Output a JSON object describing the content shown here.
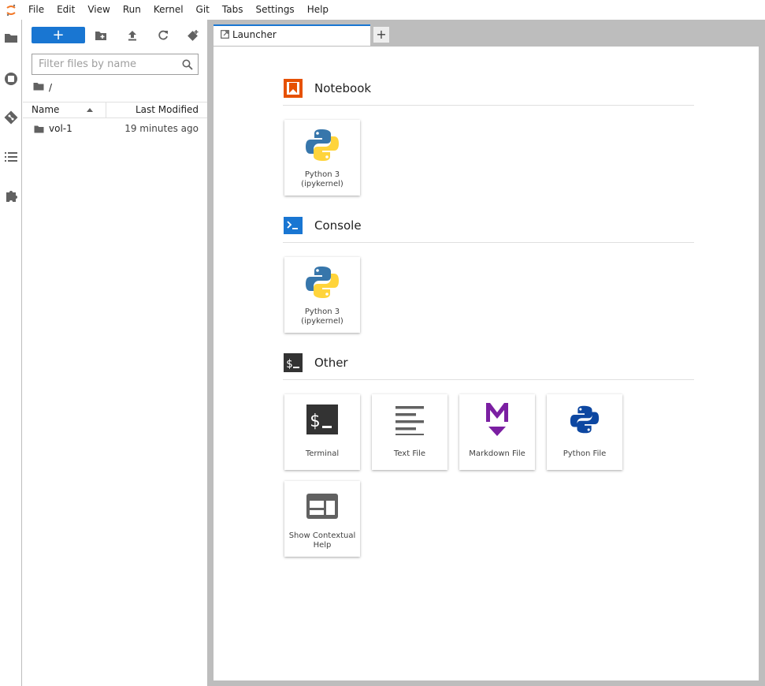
{
  "menu": [
    "File",
    "Edit",
    "View",
    "Run",
    "Kernel",
    "Git",
    "Tabs",
    "Settings",
    "Help"
  ],
  "activity_icons": [
    "folder-icon",
    "running-icon",
    "git-icon",
    "toc-icon",
    "extension-icon"
  ],
  "toolbar": {
    "new_label": "+",
    "icons": [
      "new-folder-icon",
      "upload-icon",
      "refresh-icon",
      "git-clone-icon"
    ]
  },
  "filter": {
    "placeholder": "Filter files by name"
  },
  "breadcrumb": {
    "path": "/"
  },
  "file_list": {
    "columns": {
      "name": "Name",
      "modified": "Last Modified"
    },
    "sort": "ascending",
    "rows": [
      {
        "name": "vol-1",
        "modified": "19 minutes ago",
        "type": "folder"
      }
    ]
  },
  "tabs": [
    {
      "label": "Launcher",
      "icon": "launcher-icon"
    }
  ],
  "tab_add_label": "+",
  "launcher": {
    "sections": [
      {
        "title": "Notebook",
        "icon": "notebook-icon",
        "accent": "#e65100",
        "items": [
          {
            "line1": "Python 3",
            "line2": "(ipykernel)",
            "icon": "python-icon"
          }
        ]
      },
      {
        "title": "Console",
        "icon": "console-icon",
        "accent": "#1976d2",
        "items": [
          {
            "line1": "Python 3",
            "line2": "(ipykernel)",
            "icon": "python-icon"
          }
        ]
      },
      {
        "title": "Other",
        "icon": "other-terminal-icon",
        "accent": "#333333",
        "items": [
          {
            "label": "Terminal",
            "icon": "terminal-icon"
          },
          {
            "label": "Text File",
            "icon": "text-file-icon"
          },
          {
            "label": "Markdown File",
            "icon": "markdown-icon",
            "color": "#7b1fa2"
          },
          {
            "label": "Python File",
            "icon": "python-file-icon",
            "color": "#0d47a1"
          },
          {
            "line1": "Show Contextual",
            "line2": "Help",
            "icon": "contextual-help-icon"
          }
        ]
      }
    ]
  },
  "colors": {
    "accent": "#1976d2",
    "border": "#bdbdbd"
  }
}
